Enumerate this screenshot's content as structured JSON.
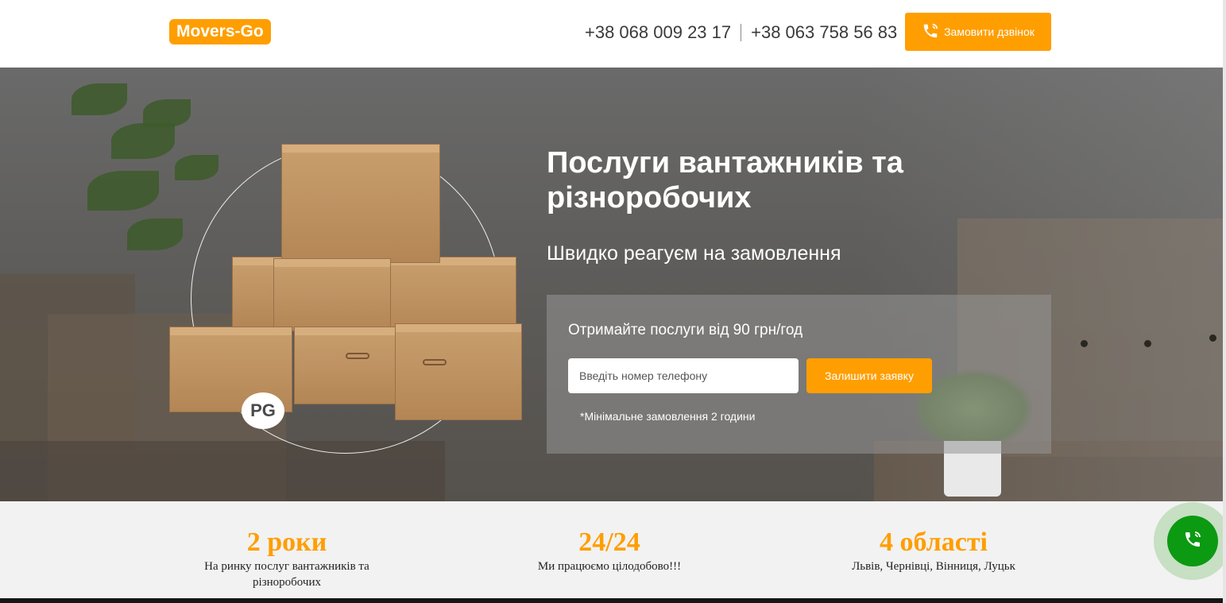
{
  "header": {
    "logo": "Movers-Go",
    "phone_1": "+38 068 009 23 17",
    "phone_2": "+38 063 758 56 83",
    "call_button": "Замовити дзвінок"
  },
  "hero": {
    "title": "Послуги вантажників та різноробочих",
    "subtitle": "Швидко реагуєм на замовлення",
    "form": {
      "title": "Отримайте послуги від 90 грн/год",
      "phone_placeholder": "Введіть номер телефону",
      "submit_label": "Залишити заявку",
      "note": "*Мінімальне замовлення 2 години"
    },
    "badge_logo": "PG"
  },
  "stats": [
    {
      "value": "2 роки",
      "description": "На ринку послуг вантажників та різноробочих"
    },
    {
      "value": "24/24",
      "description": "Ми працюємо цілодобово!!!"
    },
    {
      "value": "4 області",
      "description": "Львів, Чернівці, Вінниця, Луцьк"
    }
  ],
  "colors": {
    "accent": "#ff9e00",
    "call_green": "#0b9a12",
    "stats_bg": "#f2f2f2"
  },
  "icons": {
    "call_button_icon": "phone-ring-icon",
    "floating_call_icon": "phone-ring-icon"
  }
}
